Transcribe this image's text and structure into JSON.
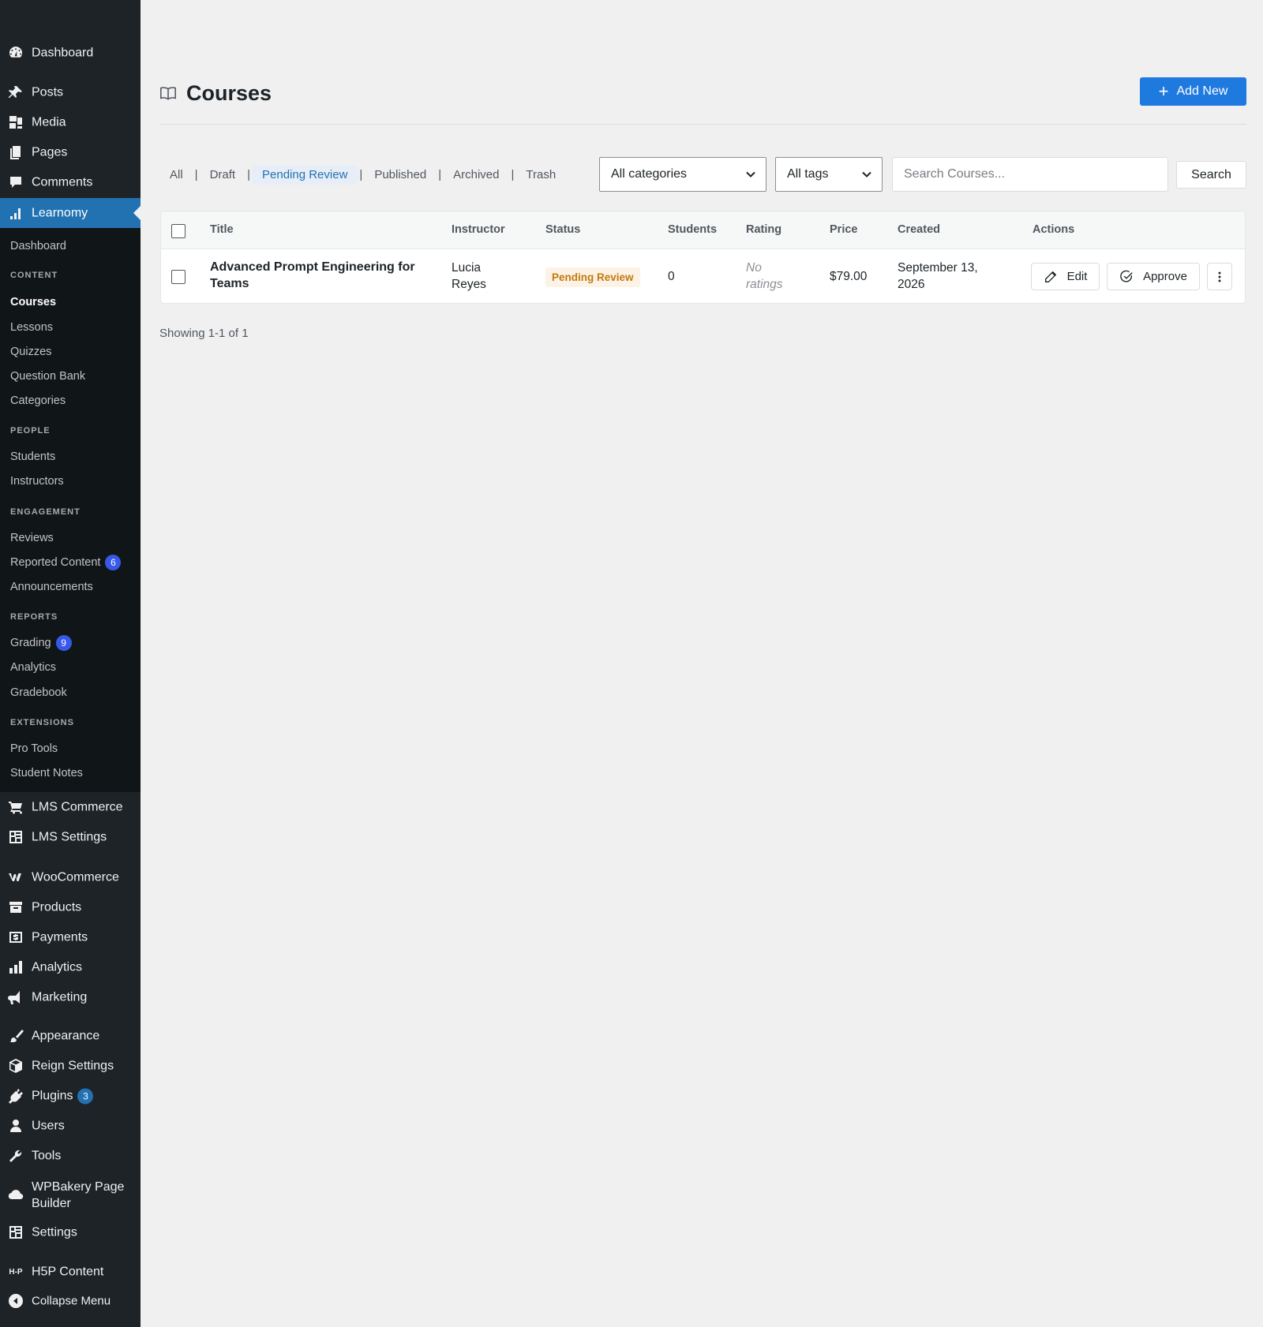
{
  "sidebar": {
    "top_items": [
      {
        "label": "Dashboard",
        "icon": "dashboard-icon"
      },
      {
        "label": "Posts",
        "icon": "pushpin-icon"
      },
      {
        "label": "Media",
        "icon": "media-icon"
      },
      {
        "label": "Pages",
        "icon": "pages-icon"
      },
      {
        "label": "Comments",
        "icon": "comment-icon"
      },
      {
        "label": "Learnomy",
        "icon": "bar-chart-icon"
      }
    ],
    "submenu": {
      "dashboard": "Dashboard",
      "content_head": "CONTENT",
      "courses": "Courses",
      "lessons": "Lessons",
      "quizzes": "Quizzes",
      "question_bank": "Question Bank",
      "categories": "Categories",
      "people_head": "PEOPLE",
      "students": "Students",
      "instructors": "Instructors",
      "engagement_head": "ENGAGEMENT",
      "reviews": "Reviews",
      "reported_content": "Reported Content",
      "reported_count": "6",
      "announcements": "Announcements",
      "reports_head": "REPORTS",
      "grading": "Grading",
      "grading_count": "9",
      "analytics": "Analytics",
      "gradebook": "Gradebook",
      "extensions_head": "EXTENSIONS",
      "pro_tools": "Pro Tools",
      "student_notes": "Student Notes"
    },
    "bottom_items": {
      "lms_commerce": "LMS Commerce",
      "lms_settings": "LMS Settings",
      "woocommerce": "WooCommerce",
      "products": "Products",
      "payments": "Payments",
      "analytics": "Analytics",
      "marketing": "Marketing",
      "appearance": "Appearance",
      "reign_settings": "Reign Settings",
      "plugins": "Plugins",
      "plugins_count": "3",
      "users": "Users",
      "tools": "Tools",
      "wpbakery_line1": "WPBakery Page",
      "wpbakery_line2": "Builder",
      "settings": "Settings",
      "h5p": "H5P Content",
      "collapse": "Collapse Menu"
    }
  },
  "header": {
    "title": "Courses",
    "add_new": "Add New"
  },
  "filters": {
    "all": "All",
    "draft": "Draft",
    "pending": "Pending Review",
    "published": "Published",
    "archived": "Archived",
    "trash": "Trash",
    "separator": "|",
    "categories_select": "All categories",
    "tags_select": "All tags",
    "search_placeholder": "Search Courses...",
    "search_button": "Search"
  },
  "table": {
    "headers": {
      "title": "Title",
      "instructor": "Instructor",
      "status": "Status",
      "students": "Students",
      "rating": "Rating",
      "price": "Price",
      "created": "Created",
      "actions": "Actions"
    },
    "rows": [
      {
        "title_line1": "Advanced Prompt Engineering for",
        "title_line2": "Teams",
        "instructor_line1": "Lucia",
        "instructor_line2": "Reyes",
        "status": "Pending Review",
        "students": "0",
        "rating_line1": "No",
        "rating_line2": "ratings",
        "price": "$79.00",
        "created_line1": "September 13,",
        "created_line2": "2026",
        "edit": "Edit",
        "approve": "Approve"
      }
    ]
  },
  "footer": {
    "showing": "Showing 1-1 of 1"
  },
  "colors": {
    "sidebar_bg": "#1d2327",
    "submenu_bg": "#101517",
    "accent": "#2271b1",
    "primary_button": "#1f7ae0",
    "pending_text": "#c27a0e",
    "pending_bg": "#fcf3e6"
  }
}
